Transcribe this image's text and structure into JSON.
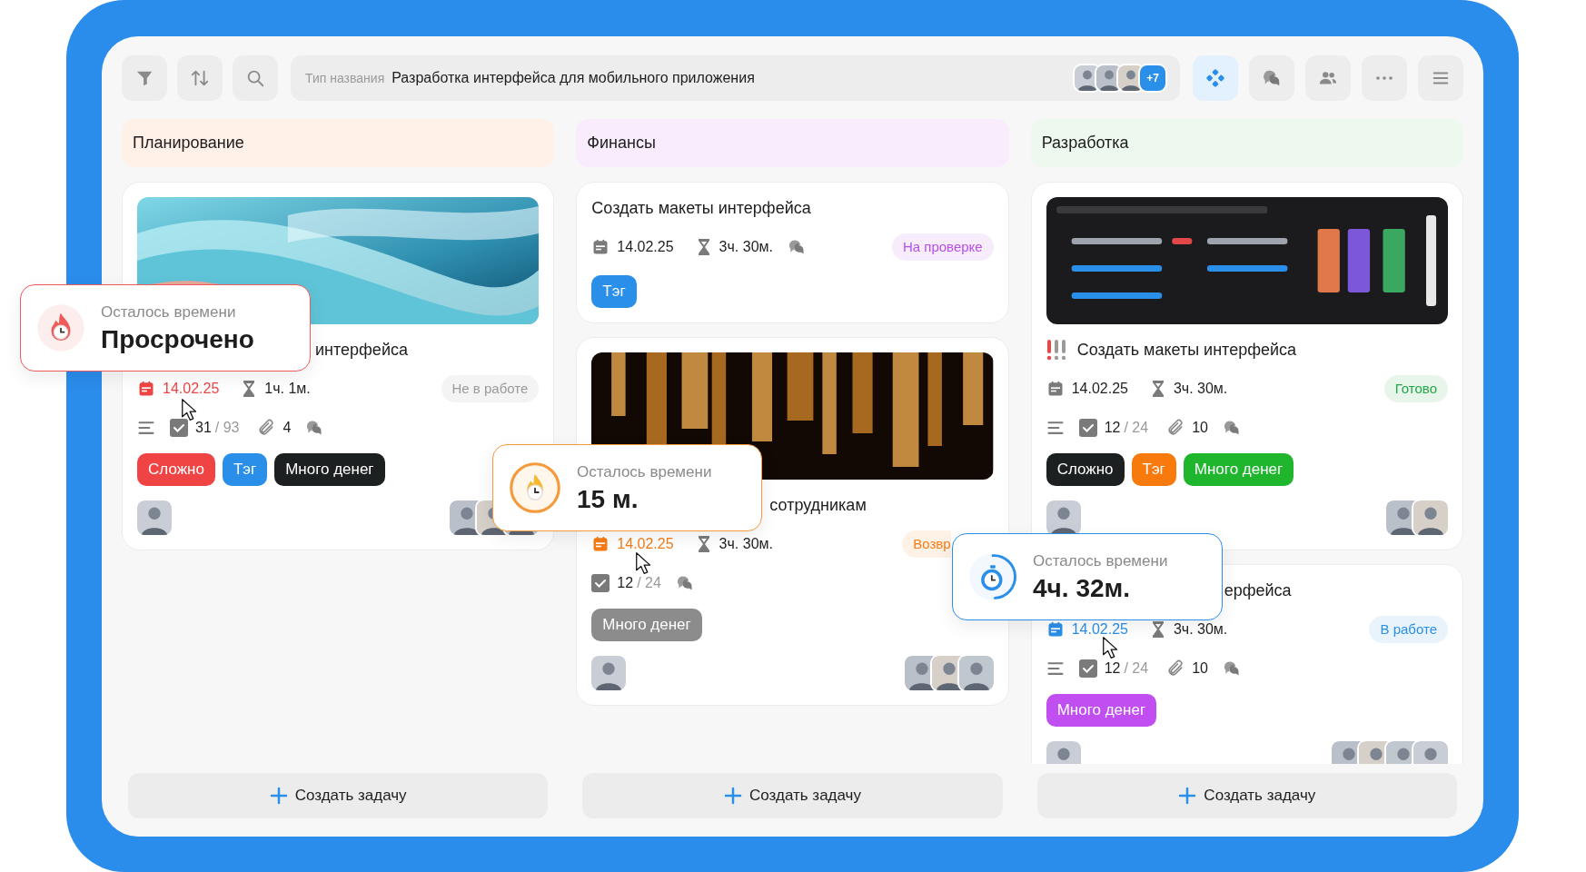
{
  "toolbar_left": [
    {
      "kind": "filter",
      "selected": false
    },
    {
      "kind": "sort",
      "selected": false
    },
    {
      "kind": "search",
      "selected": false
    }
  ],
  "title_field": {
    "label": "Тип названия",
    "value": "Разработка интерфейса для мобильного приложения",
    "members": [
      {
        "kind": "picture"
      },
      {
        "kind": "picture"
      },
      {
        "kind": "picture"
      }
    ],
    "more": "+7"
  },
  "toolbar_right": [
    {
      "kind": "apps",
      "selected": true
    },
    {
      "kind": "chat",
      "selected": false
    },
    {
      "kind": "users",
      "selected": false
    },
    {
      "kind": "more",
      "selected": false
    },
    {
      "kind": "menu",
      "selected": false
    }
  ],
  "columns": [
    {
      "title": "Планирование",
      "color": "#fff1e8",
      "create_button": "Создать задачу",
      "cards": [
        {
          "cover": {
            "kind": "picture"
          },
          "title": "интерфейса",
          "title_covered": true,
          "date": {
            "text": "14.02.25",
            "color": "#ef4444"
          },
          "duration": "1ч. 1м.",
          "status": {
            "text": "Не в работе",
            "color": "#9a9a9a",
            "covered": false
          },
          "stats": {
            "description": true,
            "done": "31",
            "total": "/ 93",
            "attachments": "4",
            "comments": true
          },
          "tags": [
            {
              "text": "Сложно",
              "color": "#f04444"
            },
            {
              "text": "Тэг",
              "color": "#2a8fe8"
            },
            {
              "text": "Много денег",
              "color": "#1d2020"
            }
          ],
          "owner": [
            {
              "kind": "picture"
            }
          ],
          "assignees": [
            {
              "kind": "picture"
            },
            {
              "kind": "picture"
            },
            {
              "kind": "picture"
            }
          ]
        }
      ]
    },
    {
      "title": "Финансы",
      "color": "#f8ecfd",
      "create_button": "Создать задачу",
      "cards": [
        {
          "title": "Создать макеты интерфейса",
          "title_covered": false,
          "date": {
            "text": "14.02.25",
            "color": "#1f1f1f"
          },
          "duration": "3ч. 30м.",
          "meta_comments": true,
          "status": {
            "text": "На проверке",
            "color": "#b84fe6",
            "covered": false
          },
          "tags": [
            {
              "text": "Тэг",
              "color": "#2a8fe8"
            }
          ]
        },
        {
          "cover": {
            "kind": "picture"
          },
          "title": "сотрудникам",
          "title_covered": true,
          "date": {
            "text": "14.02.25",
            "color": "#f57c16"
          },
          "duration": "3ч. 30м.",
          "status": {
            "text": "Возвр",
            "color": "#f57c16",
            "covered": true
          },
          "stats": {
            "done": "12",
            "total": "/ 24",
            "comments": true
          },
          "tags": [
            {
              "text": "Много денег",
              "color": "#8c8c8c"
            }
          ],
          "owner": [
            {
              "kind": "picture"
            }
          ],
          "assignees": [
            {
              "kind": "picture"
            },
            {
              "kind": "picture"
            },
            {
              "kind": "picture"
            }
          ]
        }
      ]
    },
    {
      "title": "Разработка",
      "color": "#edf9ee",
      "create_button": "Создать задачу",
      "cards": [
        {
          "cover": {
            "kind": "picture"
          },
          "title": "Создать макеты интерфейса",
          "title_covered": false,
          "priority": true,
          "date": {
            "text": "14.02.25",
            "color": "#1f1f1f"
          },
          "duration": "3ч. 30м.",
          "status": {
            "text": "Готово",
            "color": "#22a845",
            "covered": false
          },
          "stats": {
            "description": true,
            "done": "12",
            "total": "/ 24",
            "attachments": "10",
            "comments": true
          },
          "tags": [
            {
              "text": "Сложно",
              "color": "#1d2020"
            },
            {
              "text": "Тэг",
              "color": "#f97a0c"
            },
            {
              "text": "Много денег",
              "color": "#1fb52c"
            }
          ],
          "owner": [
            {
              "kind": "picture"
            }
          ],
          "assignees": [
            {
              "kind": "picture"
            },
            {
              "kind": "picture"
            }
          ]
        },
        {
          "title": "ерфейса",
          "title_covered": true,
          "date": {
            "text": "14.02.25",
            "color": "#2a8fe8"
          },
          "duration": "3ч. 30м.",
          "status": {
            "text": "В работе",
            "color": "#2a8fe8",
            "covered": false
          },
          "stats": {
            "description": true,
            "done": "12",
            "total": "/ 24",
            "attachments": "10",
            "comments": true
          },
          "tags": [
            {
              "text": "Много денег",
              "color": "#c04ef0"
            }
          ],
          "owner": [
            {
              "kind": "picture"
            }
          ],
          "assignees": [
            {
              "kind": "picture"
            },
            {
              "kind": "picture"
            },
            {
              "kind": "picture"
            },
            {
              "kind": "picture"
            }
          ]
        }
      ]
    }
  ],
  "popovers": [
    {
      "kind": "overdue",
      "color": "#ef5a5a",
      "label": "Осталось времени",
      "value": "Просрочено"
    },
    {
      "kind": "urgent",
      "color": "#f59a3c",
      "label": "Осталось времени",
      "value": "15 м."
    },
    {
      "kind": "running",
      "color": "#2a8fe8",
      "label": "Осталось времени",
      "value": "4ч. 32м."
    }
  ]
}
